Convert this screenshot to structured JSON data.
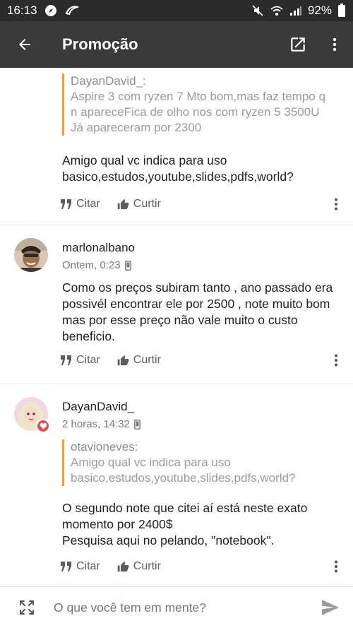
{
  "statusbar": {
    "time": "16:13",
    "battery": "92%"
  },
  "appbar": {
    "title": "Promoção"
  },
  "comments": [
    {
      "quote": {
        "author": "DayanDavid_:",
        "text": "Aspire 3 com ryzen 7 Mto bom,mas faz tempo q n apareceFica de olho nos com ryzen 5 3500U Já apareceram por 2300"
      },
      "body": "Amigo qual vc indica para uso basico,estudos,youtube,slides,pdfs,world?",
      "cite": "Citar",
      "like": "Curtir"
    },
    {
      "author": "marlonalbano",
      "meta": "Ontem, 0:23",
      "body": "Como os preços subiram tanto , ano passado era possivél encontrar ele por 2500 , note muito bom mas por esse preço não vale muito o custo beneficio.",
      "cite": "Citar",
      "like": "Curtir"
    },
    {
      "author": "DayanDavid_",
      "meta": "2 horas, 14:32",
      "quote": {
        "author": "otavioneves:",
        "text": "Amigo qual vc indica para uso basico,estudos,youtube,slides,pdfs,world?"
      },
      "body": "O segundo note que citei aí está neste exato momento por 2400$\nPesquisa aqui no pelando, \"notebook\".",
      "cite": "Citar",
      "like": "Curtir"
    }
  ],
  "composer": {
    "placeholder": "O que você tem em mente?"
  },
  "colors": {
    "appbar": "#3a3a3a",
    "statusbar": "#2b2b2b",
    "quote_border": "#f0a42a",
    "heart_badge": "#e64a4a"
  }
}
